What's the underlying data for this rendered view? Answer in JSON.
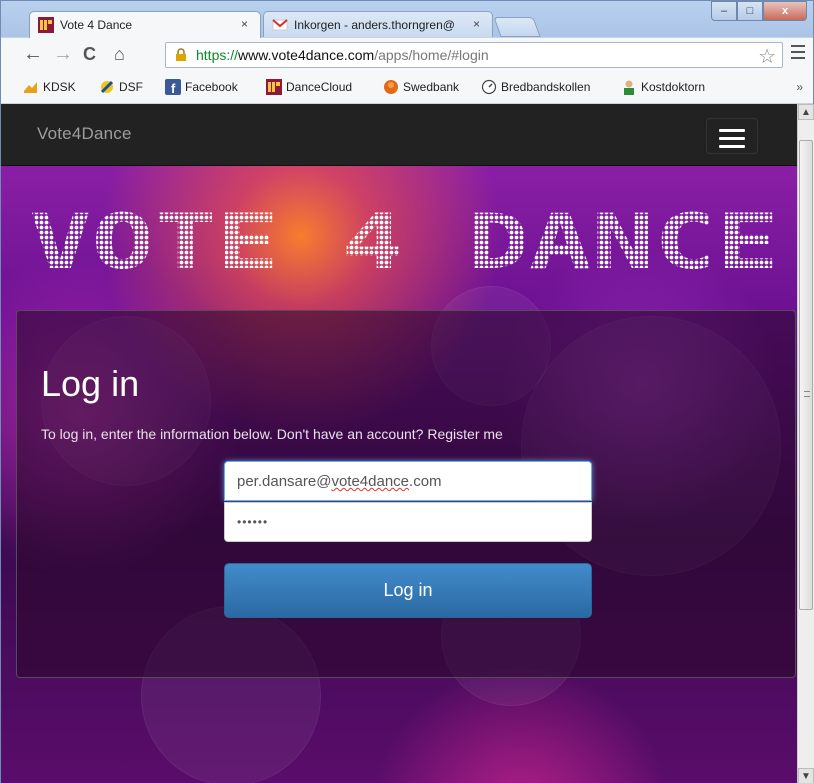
{
  "browser": {
    "tabs": [
      {
        "title": "Vote 4 Dance",
        "close": "×",
        "active": true
      },
      {
        "title": "Inkorgen - anders.thorngren@",
        "close": "×",
        "active": false
      }
    ],
    "window_buttons": {
      "minimize": "–",
      "maximize": "□",
      "close": "x"
    },
    "address": {
      "scheme": "https://",
      "host": "www.vote4dance.com",
      "path": "/apps/home/#login"
    },
    "bookmarks": [
      "KDSK",
      "DSF",
      "Facebook",
      "DanceCloud",
      "Swedbank",
      "Bredbandskollen",
      "Kostdoktorn"
    ],
    "bookmarks_more": "»",
    "colors": {
      "https": "#0b8a2b",
      "chrome": "#b9d1ee"
    }
  },
  "site": {
    "brand": "Vote4Dance",
    "logo_text": "VOTE 4 DANCE",
    "menu_icon": "hamburger-icon"
  },
  "login": {
    "heading": "Log in",
    "lead": "To log in, enter the information below. Don't have an account? Register me",
    "email_prefix": "per.dansare@",
    "email_domain": "vote4dance",
    "email_suffix": ".com",
    "password_mask": "••••••",
    "button": "Log in",
    "colors": {
      "button": "#428bca",
      "focus": "#66afe9"
    }
  }
}
